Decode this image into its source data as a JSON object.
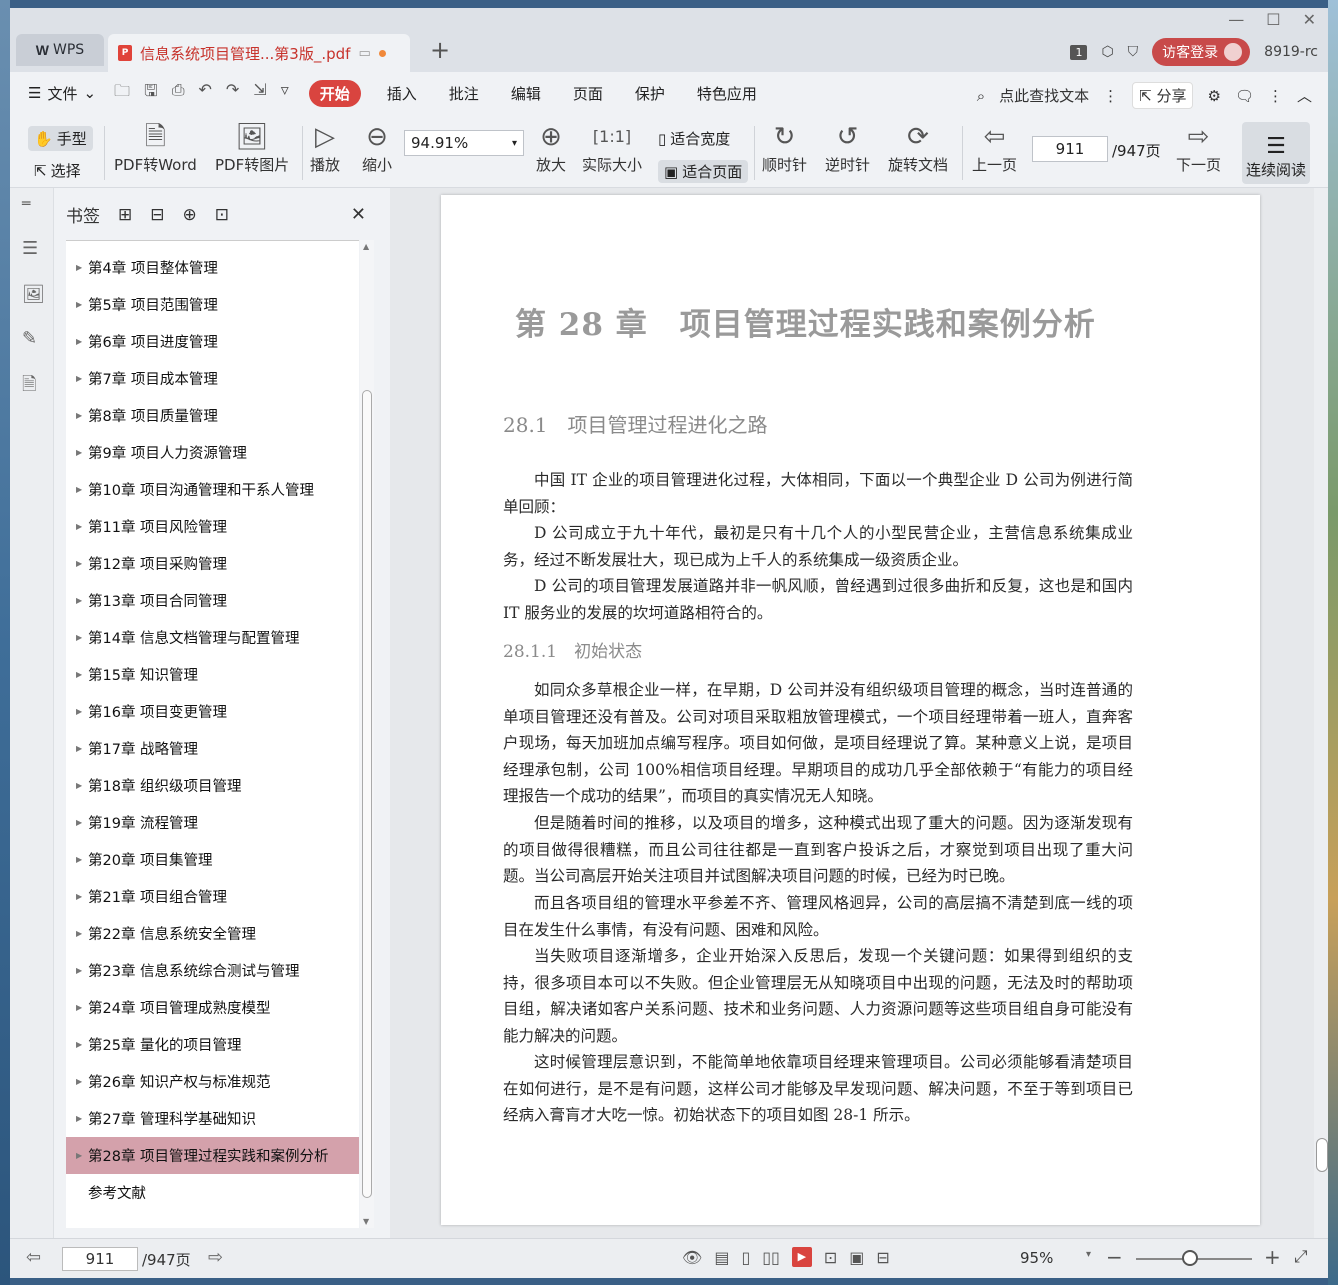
{
  "titlebar": {
    "app_name": "WPS",
    "doc_tab_title": "信息系统项目管理...第3版_.pdf",
    "window_count_badge": "1",
    "guest_login": "访客登录",
    "user_id": "8919-rc"
  },
  "menubar": {
    "file": "文件",
    "items": [
      "开始",
      "插入",
      "批注",
      "编辑",
      "页面",
      "保护",
      "特色应用"
    ],
    "active_index": 0,
    "search": "点此查找文本",
    "share": "分享"
  },
  "toolbar": {
    "hand": "手型",
    "select": "选择",
    "pdf_to_word": "PDF转Word",
    "pdf_to_image": "PDF转图片",
    "play": "播放",
    "zoom_out": "缩小",
    "zoom_value": "94.91%",
    "zoom_in": "放大",
    "actual_size": "实际大小",
    "fit_width": "适合宽度",
    "fit_page": "适合页面",
    "clockwise": "顺时针",
    "counter_clockwise": "逆时针",
    "rotate_doc": "旋转文档",
    "prev_page": "上一页",
    "page_current": "911",
    "page_total": "/947页",
    "next_page": "下一页",
    "continuous_read": "连续阅读"
  },
  "bookmarks": {
    "title": "书签",
    "selected_index": 24,
    "items": [
      "第4章 项目整体管理",
      "第5章 项目范围管理",
      "第6章 项目进度管理",
      "第7章 项目成本管理",
      "第8章 项目质量管理",
      "第9章 项目人力资源管理",
      "第10章 项目沟通管理和干系人管理",
      "第11章 项目风险管理",
      "第12章 项目采购管理",
      "第13章 项目合同管理",
      "第14章 信息文档管理与配置管理",
      "第15章 知识管理",
      "第16章 项目变更管理",
      "第17章 战略管理",
      "第18章 组织级项目管理",
      "第19章 流程管理",
      "第20章 项目集管理",
      "第21章 项目组合管理",
      "第22章 信息系统安全管理",
      "第23章 信息系统综合测试与管理",
      "第24章 项目管理成熟度模型",
      "第25章 量化的项目管理",
      "第26章 知识产权与标准规范",
      "第27章 管理科学基础知识",
      "第28章 项目管理过程实践和案例分析",
      "参考文献"
    ]
  },
  "document": {
    "chapter_title": "第 28 章　项目管理过程实践和案例分析",
    "section_1": "28.1　项目管理过程进化之路",
    "paragraphs_1": [
      "中国 IT 企业的项目管理进化过程，大体相同，下面以一个典型企业 D 公司为例进行简单回顾：",
      "D 公司成立于九十年代，最初是只有十几个人的小型民营企业，主营信息系统集成业务，经过不断发展壮大，现已成为上千人的系统集成一级资质企业。",
      "D 公司的项目管理发展道路并非一帆风顺，曾经遇到过很多曲折和反复，这也是和国内 IT 服务业的发展的坎坷道路相符合的。"
    ],
    "section_2": "28.1.1　初始状态",
    "paragraphs_2": [
      "如同众多草根企业一样，在早期，D 公司并没有组织级项目管理的概念，当时连普通的单项目管理还没有普及。公司对项目采取粗放管理模式，一个项目经理带着一班人，直奔客户现场，每天加班加点编写程序。项目如何做，是项目经理说了算。某种意义上说，是项目经理承包制，公司 100%相信项目经理。早期项目的成功几乎全部依赖于“有能力的项目经理报告一个成功的结果”，而项目的真实情况无人知晓。",
      "但是随着时间的推移，以及项目的增多，这种模式出现了重大的问题。因为逐渐发现有的项目做得很糟糕，而且公司往往都是一直到客户投诉之后，才察觉到项目出现了重大问题。当公司高层开始关注项目并试图解决项目问题的时候，已经为时已晚。",
      "而且各项目组的管理水平参差不齐、管理风格迥异，公司的高层搞不清楚到底一线的项目在发生什么事情，有没有问题、困难和风险。",
      "当失败项目逐渐增多，企业开始深入反思后，发现一个关键问题：如果得到组织的支持，很多项目本可以不失败。但企业管理层无从知晓项目中出现的问题，无法及时的帮助项目组，解决诸如客户关系问题、技术和业务问题、人力资源问题等这些项目组自身可能没有能力解决的问题。",
      "这时候管理层意识到，不能简单地依靠项目经理来管理项目。公司必须能够看清楚项目在如何进行，是不是有问题，这样公司才能够及早发现问题、解决问题，不至于等到项目已经病入膏肓才大吃一惊。初始状态下的项目如图 28-1 所示。"
    ]
  },
  "statusbar": {
    "page_current": "911",
    "page_total": "/947页",
    "zoom": "95%"
  },
  "colors": {
    "accent": "#d9443f",
    "bookmark_selected": "#d4a1ab",
    "tab_text": "#c7322b"
  }
}
